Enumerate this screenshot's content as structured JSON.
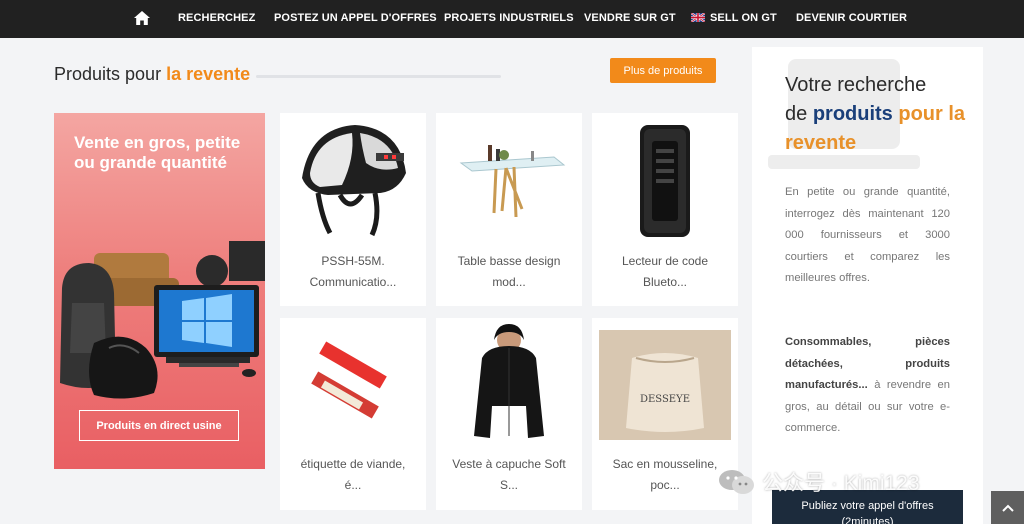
{
  "nav": {
    "items": [
      "RECHERCHEZ",
      "POSTEZ UN APPEL D'OFFRES",
      "PROJETS INDUSTRIELS",
      "VENDRE SUR GT",
      "SELL ON GT",
      "DEVENIR COURTIER"
    ],
    "home_icon": "home-icon",
    "flag_icon": "uk-flag-icon"
  },
  "section": {
    "title_prefix": "Produits pour",
    "title_accent": "la revente",
    "more_button": "Plus de produits"
  },
  "promo": {
    "title": "Vente en gros, petite ou grande quantité",
    "button": "Produits en direct usine"
  },
  "products": [
    {
      "line1": "PSSH-55M.",
      "line2": "Communicatio..."
    },
    {
      "line1": "Table basse design",
      "line2": "mod..."
    },
    {
      "line1": "Lecteur de code",
      "line2": "Blueto..."
    },
    {
      "line1": "étiquette de viande,",
      "line2": "é..."
    },
    {
      "line1": "Veste à capuche Soft",
      "line2": "S..."
    },
    {
      "line1": "Sac en mousseline,",
      "line2": "poc..."
    }
  ],
  "side": {
    "heading_1": "Votre recherche",
    "heading_2": "de",
    "heading_blue": "produits",
    "heading_orange": "pour la revente",
    "para1": "En petite ou grande quantité, interrogez dès maintenant 120 000 fournisseurs et 3000 courtiers et comparez les meilleures offres.",
    "para2_bold": "Consommables, pièces détachées, produits manufacturés...",
    "para2_rest": " à revendre en gros, au détail ou sur votre e-commerce."
  },
  "cta": {
    "line1": "Publiez votre appel d'offres",
    "line2": "(2minutes)"
  },
  "watermark": "公众号 · Kimi123",
  "colors": {
    "accent": "#f28a1a",
    "nav_bg": "#212121",
    "heading_blue": "#1a3f7a",
    "cta_bg": "#1c2b3c"
  }
}
